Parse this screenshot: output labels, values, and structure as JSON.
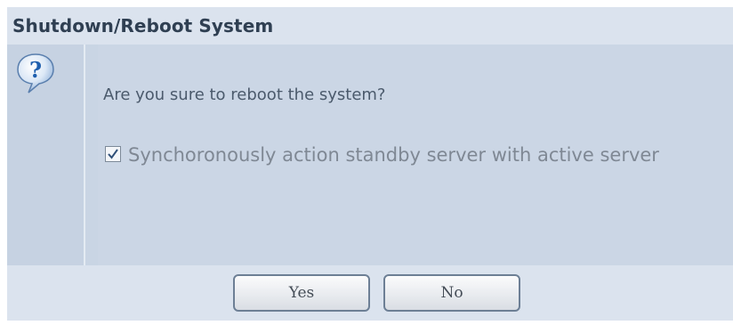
{
  "dialog": {
    "title": "Shutdown/Reboot System",
    "icon": "question-icon",
    "prompt": "Are you sure to reboot the system?",
    "option": {
      "checked": true,
      "label": "Synchoronously action standby server with active server"
    },
    "buttons": {
      "yes_label": "Yes",
      "no_label": "No"
    }
  },
  "colors": {
    "dialog_bg": "#d3dde9",
    "title_text": "#2f3f52",
    "icon_blue": "#2f6fb8"
  }
}
